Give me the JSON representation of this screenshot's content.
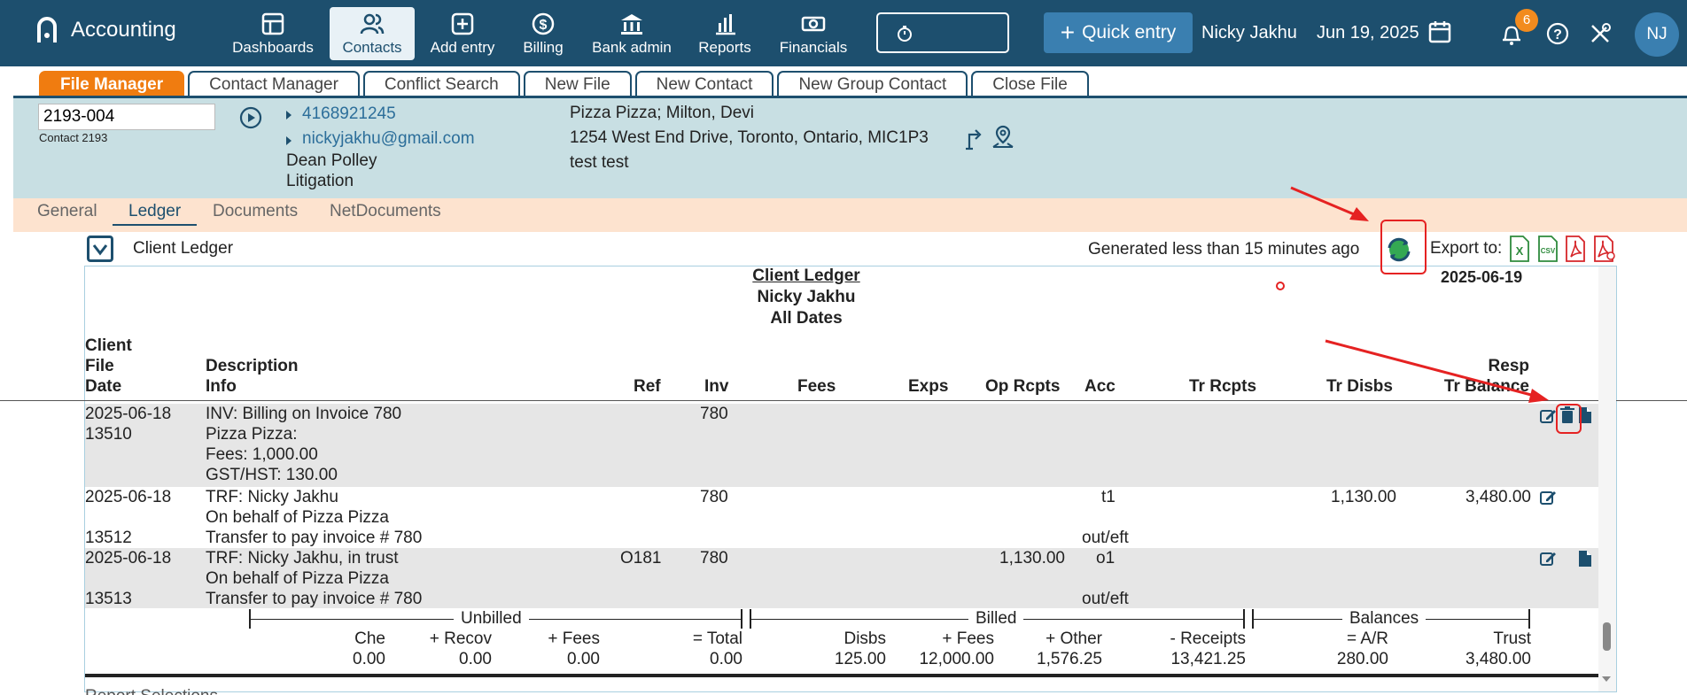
{
  "app": {
    "name": "Accounting"
  },
  "nav": {
    "items": [
      {
        "label": "Dashboards",
        "icon": "dashboard-icon"
      },
      {
        "label": "Contacts",
        "icon": "contacts-icon"
      },
      {
        "label": "Add entry",
        "icon": "add-entry-icon"
      },
      {
        "label": "Billing",
        "icon": "dollar-icon"
      },
      {
        "label": "Bank admin",
        "icon": "bank-icon"
      },
      {
        "label": "Reports",
        "icon": "bar-chart-icon"
      },
      {
        "label": "Financials",
        "icon": "money-icon"
      }
    ],
    "active": "Contacts",
    "quick_entry": "Quick entry",
    "user": "Nicky Jakhu",
    "date": "Jun 19, 2025",
    "notification_count": "6",
    "avatar_initials": "NJ"
  },
  "tabs": [
    "File Manager",
    "Contact Manager",
    "Conflict Search",
    "New File",
    "New Contact",
    "New Group Contact",
    "Close File"
  ],
  "file_header": {
    "file_number": "2193-004",
    "contact_label": "Contact 2193",
    "phone": "4168921245",
    "email": "nickyjakhu@gmail.com",
    "person": "Dean Polley",
    "practice": "Litigation",
    "client_line": "Pizza Pizza; Milton, Devi",
    "address": "1254 West End Drive, Toronto, Ontario, MIC1P3",
    "note": "test test"
  },
  "subtabs": [
    "General",
    "Ledger",
    "Documents",
    "NetDocuments"
  ],
  "ledger_bar": {
    "title": "Client Ledger",
    "generated": "Generated less than 15 minutes ago",
    "export_label": "Export to:",
    "export_icons": [
      "excel-icon",
      "csv-icon",
      "pdf-icon",
      "pdf-alt-icon"
    ]
  },
  "report": {
    "title": "Client Ledger",
    "client": "Nicky Jakhu",
    "range": "All Dates",
    "date": "2025-06-19",
    "headers": {
      "client": "Client",
      "file": "File",
      "date": "Date",
      "description": "Description",
      "info": "Info",
      "ref": "Ref",
      "inv": "Inv",
      "fees": "Fees",
      "exps": "Exps",
      "op_rcpts": "Op Rcpts",
      "acc": "Acc",
      "tr_rcpts": "Tr Rcpts",
      "tr_disbs": "Tr Disbs",
      "resp": "Resp",
      "tr_balance": "Tr Balance"
    },
    "rows": [
      {
        "date": "2025-06-18",
        "id": "13510",
        "desc": [
          "INV: Billing on Invoice 780",
          "Pizza Pizza:",
          "Fees: 1,000.00",
          "GST/HST: 130.00"
        ],
        "ref": "",
        "inv": "780",
        "op_rcpts": "",
        "acc": "",
        "acc2": "",
        "tr_disbs": "",
        "tr_balance": ""
      },
      {
        "date": "2025-06-18",
        "id": "13512",
        "desc": [
          "TRF: Nicky Jakhu",
          "On behalf of Pizza Pizza",
          "Transfer to pay invoice # 780"
        ],
        "ref": "",
        "inv": "780",
        "op_rcpts": "",
        "acc": "t1",
        "acc2": "out/eft",
        "tr_disbs": "1,130.00",
        "tr_balance": "3,480.00"
      },
      {
        "date": "2025-06-18",
        "id": "13513",
        "desc": [
          "TRF: Nicky Jakhu, in trust",
          "On behalf of Pizza Pizza",
          "Transfer to pay invoice # 780"
        ],
        "ref": "O181",
        "inv": "780",
        "op_rcpts": "1,130.00",
        "acc": "o1",
        "acc2": "out/eft",
        "tr_disbs": "",
        "tr_balance": ""
      }
    ],
    "summary": {
      "groups": [
        "Unbilled",
        "Billed",
        "Balances"
      ],
      "labels": [
        "Che",
        "+ Recov",
        "+ Fees",
        "= Total",
        "Disbs",
        "+ Fees",
        "+ Other",
        "- Receipts",
        "= A/R",
        "Trust"
      ],
      "values": [
        "0.00",
        "0.00",
        "0.00",
        "0.00",
        "125.00",
        "12,000.00",
        "1,576.25",
        "13,421.25",
        "280.00",
        "3,480.00"
      ]
    },
    "footer_cut": "Report Selections"
  }
}
